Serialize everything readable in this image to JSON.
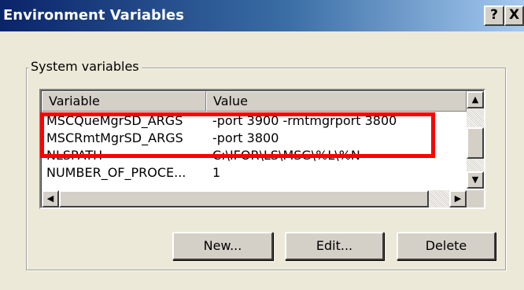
{
  "window": {
    "title": "Environment Variables",
    "help_label": "?",
    "close_label": "X"
  },
  "group": {
    "label": "System variables"
  },
  "table": {
    "headers": [
      "Variable",
      "Value"
    ],
    "rows": [
      {
        "variable": "MSCQueMgrSD_ARGS",
        "value": "-port 3900 -rmtmgrport 3800"
      },
      {
        "variable": "MSCRmtMgrSD_ARGS",
        "value": "-port 3800"
      },
      {
        "variable": "NLSPATH",
        "value": "C:\\IFOR\\LS\\MSG\\%L\\%N"
      },
      {
        "variable": "NUMBER_OF_PROCE...",
        "value": "1"
      }
    ]
  },
  "scrollbar": {
    "up_icon": "scroll-up-arrow",
    "down_icon": "scroll-down-arrow",
    "left_icon": "scroll-left-arrow",
    "right_icon": "scroll-right-arrow"
  },
  "buttons": {
    "new_label": "New...",
    "edit_label": "Edit...",
    "delete_label": "Delete"
  },
  "annotation": {
    "highlight_color": "#ff0000"
  },
  "colors": {
    "title_bar_start": "#0a246a",
    "title_bar_end": "#a6caf0",
    "dialog_background": "#ece9d8",
    "button_face": "#d4d0c8"
  }
}
